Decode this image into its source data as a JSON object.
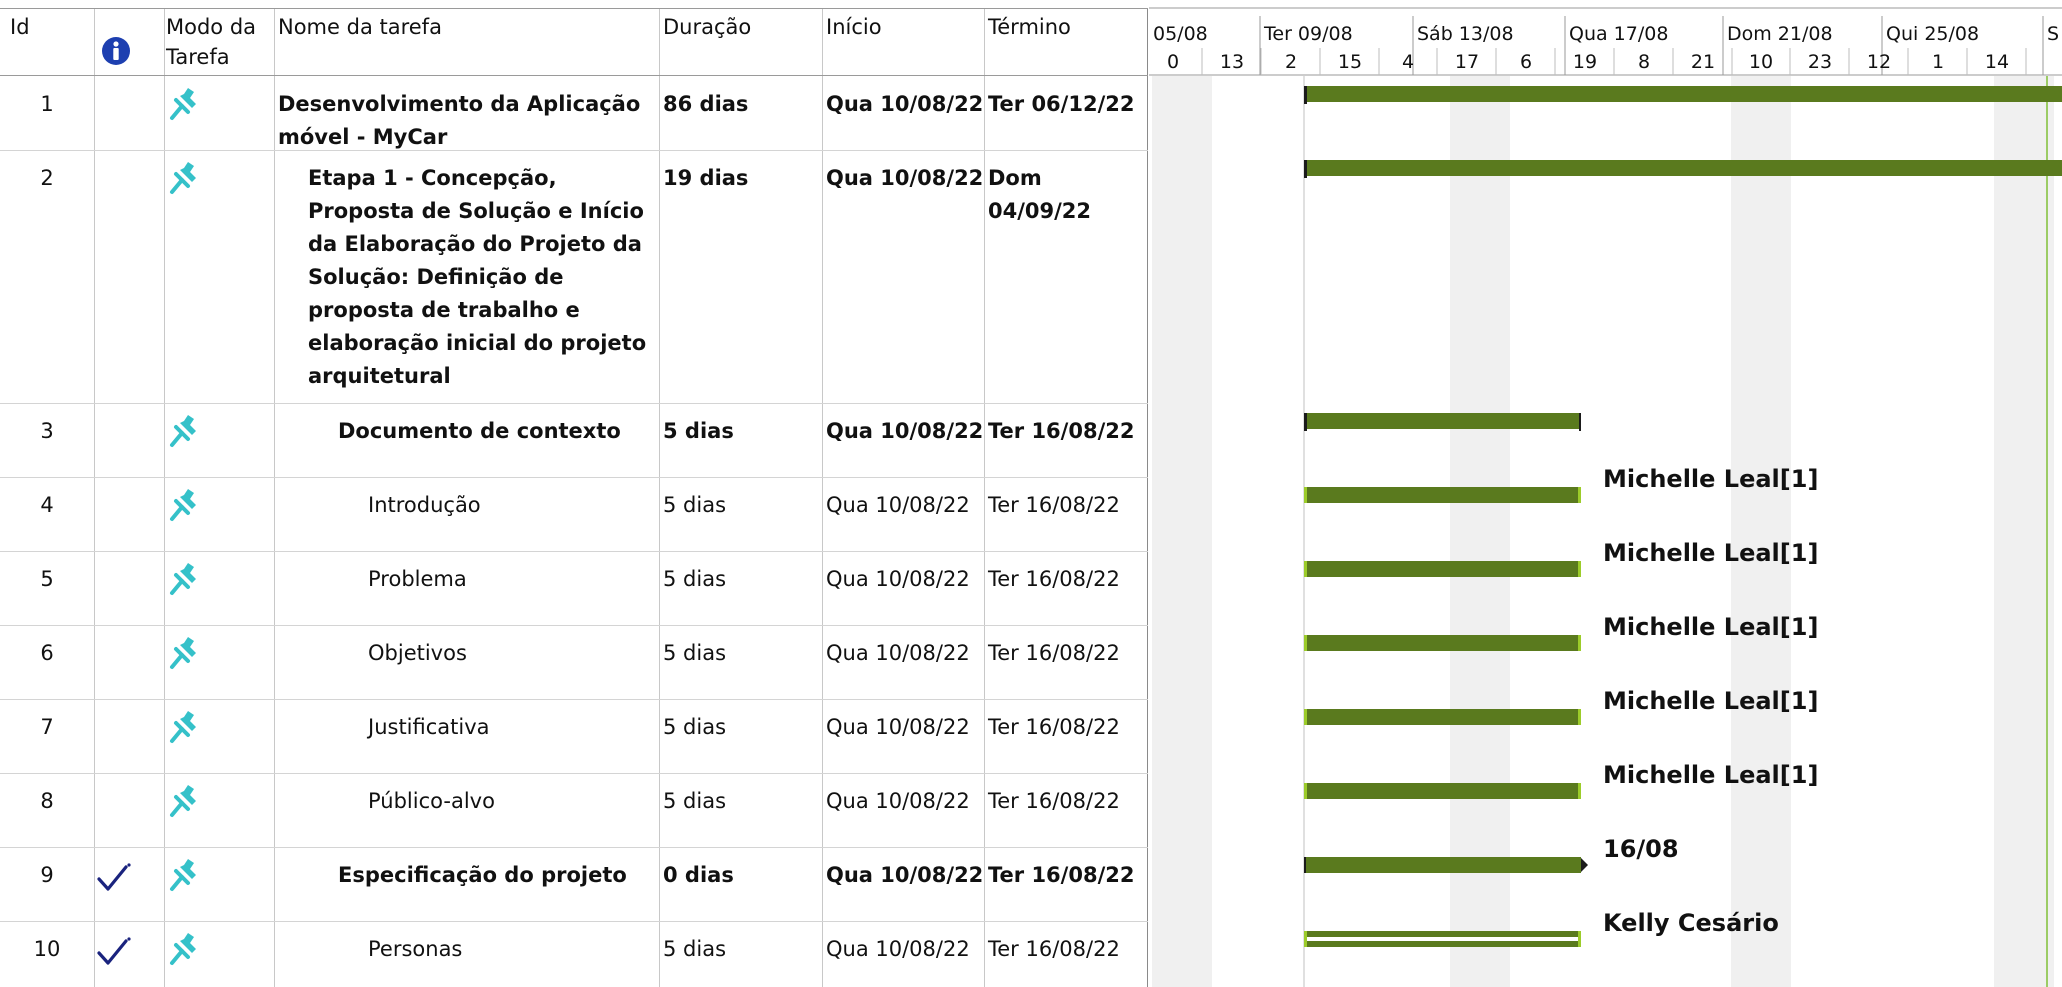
{
  "columns": {
    "id": "Id",
    "info_icon": "info-icon",
    "mode": "Modo da\nTarefa",
    "name": "Nome da tarefa",
    "duration": "Duração",
    "start": "Início",
    "finish": "Término"
  },
  "timescale": {
    "major": [
      "05/08",
      "Ter 09/08",
      "Sáb 13/08",
      "Qua 17/08",
      "Dom 21/08",
      "Qui 25/08",
      "S"
    ],
    "minor": [
      "0",
      "13",
      "2",
      "15",
      "4",
      "17",
      "6",
      "19",
      "8",
      "21",
      "10",
      "23",
      "12",
      "1",
      "14"
    ]
  },
  "tasks": [
    {
      "id": "1",
      "name": "Desenvolvimento da Aplicação móvel - MyCar",
      "duration": "86 dias",
      "start": "Qua 10/08/22",
      "finish": "Ter 06/12/22",
      "summary": true,
      "complete": false,
      "mode_icon": "pin-icon",
      "label": ""
    },
    {
      "id": "2",
      "name": "Etapa 1 - Concepção, Proposta de Solução e Início da Elaboração do Projeto da Solução: Definição de proposta de trabalho e elaboração inicial do projeto arquitetural",
      "duration": "19 dias",
      "start": "Qua 10/08/22",
      "finish": "Dom 04/09/22",
      "summary": true,
      "complete": false,
      "mode_icon": "pin-icon",
      "label": ""
    },
    {
      "id": "3",
      "name": "Documento de contexto",
      "duration": "5 dias",
      "start": "Qua 10/08/22",
      "finish": "Ter 16/08/22",
      "summary": true,
      "complete": false,
      "mode_icon": "pin-icon",
      "label": ""
    },
    {
      "id": "4",
      "name": "Introdução",
      "duration": "5 dias",
      "start": "Qua 10/08/22",
      "finish": "Ter 16/08/22",
      "summary": false,
      "complete": false,
      "mode_icon": "pin-icon",
      "label": "Michelle Leal[1]"
    },
    {
      "id": "5",
      "name": "Problema",
      "duration": "5 dias",
      "start": "Qua 10/08/22",
      "finish": "Ter 16/08/22",
      "summary": false,
      "complete": false,
      "mode_icon": "pin-icon",
      "label": "Michelle Leal[1]"
    },
    {
      "id": "6",
      "name": "Objetivos",
      "duration": "5 dias",
      "start": "Qua 10/08/22",
      "finish": "Ter 16/08/22",
      "summary": false,
      "complete": false,
      "mode_icon": "pin-icon",
      "label": "Michelle Leal[1]"
    },
    {
      "id": "7",
      "name": "Justificativa",
      "duration": "5 dias",
      "start": "Qua 10/08/22",
      "finish": "Ter 16/08/22",
      "summary": false,
      "complete": false,
      "mode_icon": "pin-icon",
      "label": "Michelle Leal[1]"
    },
    {
      "id": "8",
      "name": "Público-alvo",
      "duration": "5 dias",
      "start": "Qua 10/08/22",
      "finish": "Ter 16/08/22",
      "summary": false,
      "complete": false,
      "mode_icon": "pin-icon",
      "label": "Michelle Leal[1]"
    },
    {
      "id": "9",
      "name": "Especificação do projeto",
      "duration": "0 dias",
      "start": "Qua 10/08/22",
      "finish": "Ter 16/08/22",
      "summary": true,
      "complete": true,
      "mode_icon": "pin-icon",
      "label": "16/08"
    },
    {
      "id": "10",
      "name": "Personas",
      "duration": "5 dias",
      "start": "Qua 10/08/22",
      "finish": "Ter 16/08/22",
      "summary": false,
      "complete": true,
      "mode_icon": "pin-icon",
      "label": "Kelly Cesário"
    }
  ],
  "colors": {
    "bar": "#5a7a1e",
    "bar_highlight": "#9ccc2a",
    "weekend_shade": "#f0f0f0",
    "today_line": "#9ccc65",
    "pin": "#35c1c9",
    "check": "#1a237e",
    "info": "#1d3fb0"
  }
}
